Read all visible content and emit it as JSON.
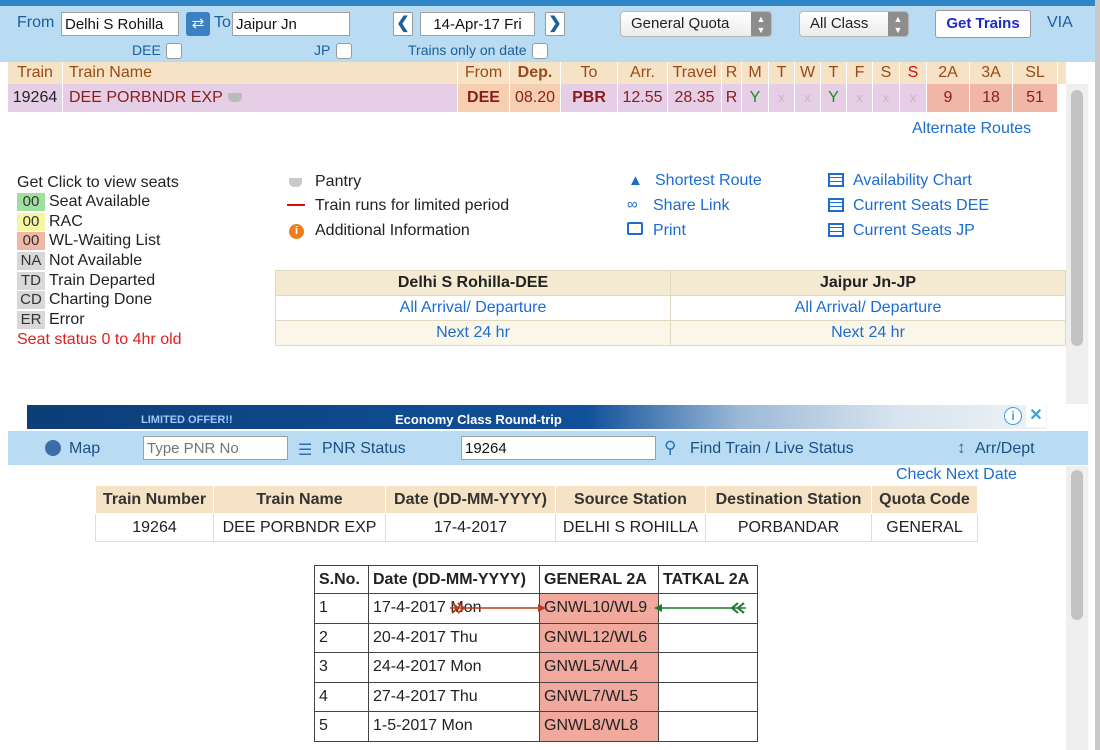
{
  "search": {
    "from_label": "From",
    "from_value": "Delhi S Rohilla",
    "to_label": "To",
    "to_value": "Jaipur Jn",
    "date_value": "14-Apr-17 Fri",
    "quota_value": "General Quota",
    "class_value": "All Class",
    "get_trains_label": "Get Trains",
    "via_label": "VIA",
    "from_code": "DEE",
    "to_code": "JP",
    "trains_only_label": "Trains only on date"
  },
  "train_header": [
    "Train",
    "Train Name",
    "From",
    "Dep.",
    "To",
    "Arr.",
    "Travel",
    "R",
    "M",
    "T",
    "W",
    "T",
    "F",
    "S",
    "S",
    "2A",
    "3A",
    "SL"
  ],
  "train_row": {
    "number": "19264",
    "name": "DEE PORBNDR EXP",
    "from": "DEE",
    "dep": "08.20",
    "to": "PBR",
    "arr": "12.55",
    "travel": "28.35",
    "r": "R",
    "days": [
      "Y",
      "x",
      "x",
      "Y",
      "x",
      "x",
      "x"
    ],
    "seats_2a": "9",
    "seats_3a": "18",
    "seats_sl": "51"
  },
  "alternate_routes": "Alternate Routes",
  "legend": {
    "title": "Get Click to view seats",
    "items": [
      {
        "code": "00",
        "label": "Seat Available",
        "color": "#9fe09f"
      },
      {
        "code": "00",
        "label": "RAC",
        "color": "#f7f6a0"
      },
      {
        "code": "00",
        "label": "WL-Waiting List",
        "color": "#f0b7a8"
      },
      {
        "code": "NA",
        "label": "Not Available",
        "color": "#d8d8d8"
      },
      {
        "code": "TD",
        "label": "Train Departed",
        "color": "#d8d8d8"
      },
      {
        "code": "CD",
        "label": "Charting Done",
        "color": "#d8d8d8"
      },
      {
        "code": "ER",
        "label": "Error",
        "color": "#d8d8d8"
      }
    ],
    "note": "Seat status 0 to 4hr old"
  },
  "info": {
    "pantry": "Pantry",
    "limited": "Train runs for limited period",
    "additional": "Additional Information"
  },
  "actions": {
    "shortest_route": "Shortest Route",
    "share_link": "Share Link",
    "print": "Print",
    "availability_chart": "Availability Chart",
    "current_seats_dee": "Current Seats DEE",
    "current_seats_jp": "Current Seats JP"
  },
  "stations": {
    "left_title": "Delhi S Rohilla-DEE",
    "right_title": "Jaipur Jn-JP",
    "arrdep": "All Arrival/ Departure",
    "next24": "Next 24 hr"
  },
  "ad": {
    "left_text": "LIMITED OFFER!!",
    "center_text": "Economy Class Round-trip"
  },
  "toolbar": {
    "map_label": "Map",
    "pnr_placeholder": "Type PNR No",
    "pnr_status_label": "PNR Status",
    "train_value": "19264",
    "find_train_label": "Find Train / Live Status",
    "arrdept_label": "Arr/Dept"
  },
  "check_next_date": "Check Next Date",
  "details": {
    "headers": [
      "Train Number",
      "Train Name",
      "Date (DD-MM-YYYY)",
      "Source Station",
      "Destination Station",
      "Quota Code"
    ],
    "values": [
      "19264",
      "DEE PORBNDR EXP",
      "17-4-2017",
      "DELHI S ROHILLA",
      "PORBANDAR",
      "GENERAL"
    ]
  },
  "avail": {
    "headers": [
      "S.No.",
      "Date (DD-MM-YYYY)",
      "GENERAL 2A",
      "TATKAL 2A"
    ],
    "rows": [
      {
        "sno": "1",
        "date": "17-4-2017 Mon",
        "gen": "GNWL10/WL9",
        "tat": ""
      },
      {
        "sno": "2",
        "date": "20-4-2017 Thu",
        "gen": "GNWL12/WL6",
        "tat": ""
      },
      {
        "sno": "3",
        "date": "24-4-2017 Mon",
        "gen": "GNWL5/WL4",
        "tat": ""
      },
      {
        "sno": "4",
        "date": "27-4-2017 Thu",
        "gen": "GNWL7/WL5",
        "tat": ""
      },
      {
        "sno": "5",
        "date": "1-5-2017 Mon",
        "gen": "GNWL8/WL8",
        "tat": ""
      }
    ]
  }
}
